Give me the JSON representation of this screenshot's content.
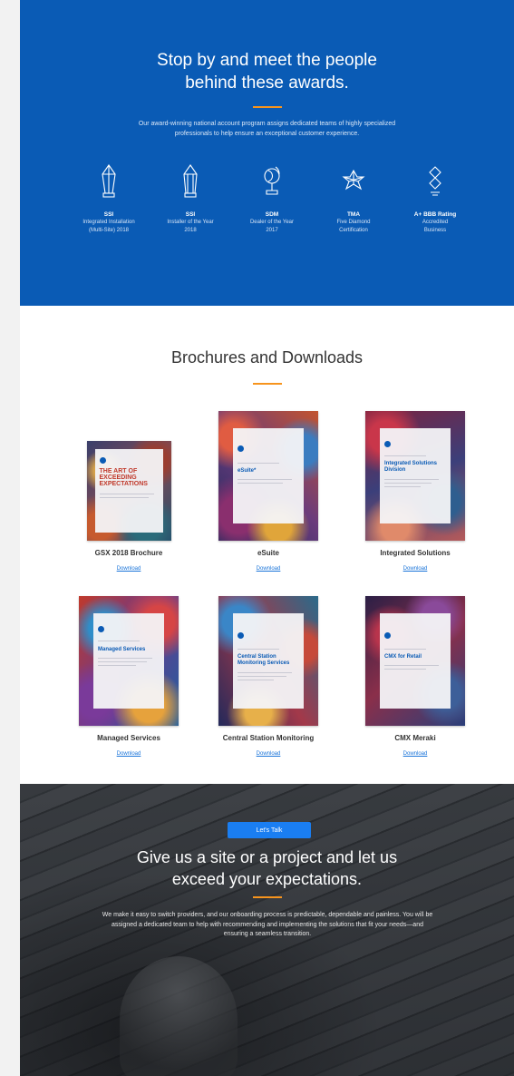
{
  "awards": {
    "title_line1": "Stop by and meet the people",
    "title_line2": "behind these awards.",
    "subtitle": "Our award-winning national account program assigns dedicated teams of highly specialized professionals to help ensure an exceptional customer experience.",
    "items": [
      {
        "org": "SSI",
        "desc_line1": "Integrated Installation",
        "desc_line2": "(Multi-Site) 2018",
        "icon": "trophy-crystal-icon"
      },
      {
        "org": "SSI",
        "desc_line1": "Installer of the Year",
        "desc_line2": "2018",
        "icon": "trophy-crystal-icon"
      },
      {
        "org": "SDM",
        "desc_line1": "Dealer of the Year",
        "desc_line2": "2017",
        "icon": "trophy-sphere-icon"
      },
      {
        "org": "TMA",
        "desc_line1": "Five Diamond",
        "desc_line2": "Certification",
        "icon": "diamond-star-icon"
      },
      {
        "org": "A+ BBB Rating",
        "desc_line1": "Accredited",
        "desc_line2": "Business",
        "icon": "bbb-torch-icon"
      }
    ]
  },
  "brochures": {
    "title": "Brochures and Downloads",
    "download_label": "Download",
    "items": [
      {
        "label": "GSX 2018 Brochure",
        "cover_title": "THE ART OF EXCEEDING EXPECTATIONS"
      },
      {
        "label": "eSuite",
        "cover_title": "eSuite*"
      },
      {
        "label": "Integrated Solutions",
        "cover_title": "Integrated Solutions Division"
      },
      {
        "label": "Managed Services",
        "cover_title": "Managed Services"
      },
      {
        "label": "Central Station Monitoring",
        "cover_title": "Central Station Monitoring Services"
      },
      {
        "label": "CMX Meraki",
        "cover_title": "CMX for Retail"
      }
    ]
  },
  "cta": {
    "title_line1": "Give us a site or a project and let us",
    "title_line2": "exceed your expectations.",
    "body": "We make it easy to switch providers, and our onboarding process is predictable, dependable and painless. You will be assigned a dedicated team to help with recommending and implementing the solutions that fit your needs—and ensuring a seamless transition.",
    "button_label": "Let's Talk"
  },
  "colors": {
    "awards_bg": "#0a5bb5",
    "accent": "#f7941d",
    "link": "#1a74d9",
    "button": "#1a7ef2"
  }
}
